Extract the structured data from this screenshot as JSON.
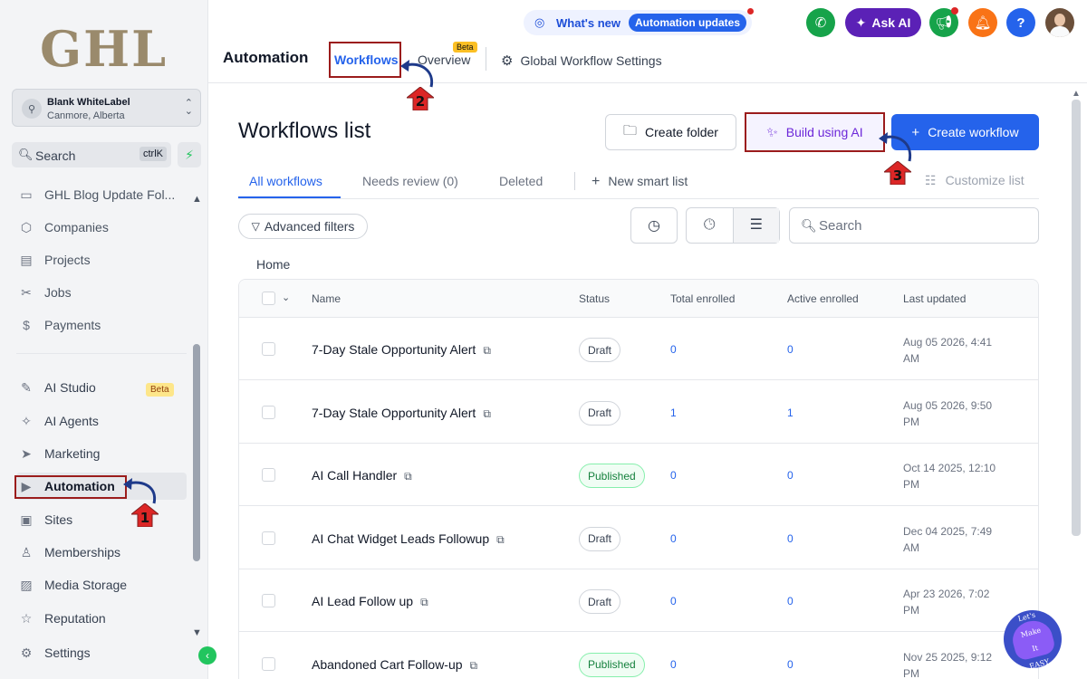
{
  "sidebar": {
    "logo": "GHL",
    "account": {
      "name": "Blank WhiteLabel",
      "location": "Canmore, Alberta"
    },
    "search": {
      "label": "Search",
      "shortcut": "ctrlK"
    },
    "items": [
      {
        "label": "GHL Blog Update Fol...",
        "icon": "blog-icon"
      },
      {
        "label": "Companies",
        "icon": "companies-icon"
      },
      {
        "label": "Projects",
        "icon": "projects-icon"
      },
      {
        "label": "Jobs",
        "icon": "jobs-icon"
      },
      {
        "label": "Payments",
        "icon": "payments-icon"
      },
      {
        "label": "AI Studio",
        "icon": "ai-studio-icon",
        "badge": "Beta"
      },
      {
        "label": "AI Agents",
        "icon": "ai-agents-icon"
      },
      {
        "label": "Marketing",
        "icon": "marketing-icon"
      },
      {
        "label": "Automation",
        "icon": "automation-icon"
      },
      {
        "label": "Sites",
        "icon": "sites-icon"
      },
      {
        "label": "Memberships",
        "icon": "memberships-icon"
      },
      {
        "label": "Media Storage",
        "icon": "media-storage-icon"
      },
      {
        "label": "Reputation",
        "icon": "reputation-icon"
      },
      {
        "label": "Settings",
        "icon": "settings-icon"
      }
    ]
  },
  "header": {
    "whats_new": "What's new",
    "automation_updates": "Automation updates",
    "ask_ai": "Ask AI",
    "app_title": "Automation",
    "tabs": [
      {
        "label": "Workflows"
      },
      {
        "label": "Overview",
        "badge": "Beta"
      },
      {
        "label": "Global Workflow Settings"
      }
    ]
  },
  "main": {
    "title": "Workflows list",
    "buttons": {
      "create_folder": "Create folder",
      "build_ai": "Build using AI",
      "create_workflow": "Create workflow"
    },
    "tabs": [
      {
        "label": "All workflows"
      },
      {
        "label": "Needs review (0)"
      },
      {
        "label": "Deleted"
      }
    ],
    "new_smart_list": "New smart list",
    "customize_list": "Customize list",
    "advanced_filters": "Advanced filters",
    "search_placeholder": "Search",
    "breadcrumb": "Home"
  },
  "table": {
    "columns": [
      "Name",
      "Status",
      "Total enrolled",
      "Active enrolled",
      "Last updated"
    ],
    "rows": [
      {
        "name": "7-Day Stale Opportunity Alert",
        "status": "Draft",
        "total": "0",
        "active": "0",
        "updated_1": "Aug 05 2026, 4:41",
        "updated_2": "AM"
      },
      {
        "name": "7-Day Stale Opportunity Alert",
        "status": "Draft",
        "total": "1",
        "active": "1",
        "updated_1": "Aug 05 2026, 9:50",
        "updated_2": "PM"
      },
      {
        "name": "AI Call Handler",
        "status": "Published",
        "total": "0",
        "active": "0",
        "updated_1": "Oct 14 2025, 12:10",
        "updated_2": "PM"
      },
      {
        "name": "AI Chat Widget Leads Followup",
        "status": "Draft",
        "total": "0",
        "active": "0",
        "updated_1": "Dec 04 2025, 7:49",
        "updated_2": "AM"
      },
      {
        "name": "AI Lead Follow up",
        "status": "Draft",
        "total": "0",
        "active": "0",
        "updated_1": "Apr 23 2026, 7:02",
        "updated_2": "PM"
      },
      {
        "name": "Abandoned Cart Follow-up",
        "status": "Published",
        "total": "0",
        "active": "0",
        "updated_1": "Nov 25 2025, 9:12",
        "updated_2": "PM"
      }
    ]
  },
  "annotations": {
    "step1": "1",
    "step2": "2",
    "step3": "3"
  },
  "watermark": {
    "line1": "Let's Make",
    "line2": "It",
    "line3": "EASY"
  },
  "colors": {
    "primary": "#2563eb",
    "annotation": "#9b1c1c",
    "ai_purple": "#5b21b6",
    "published": "#15803d"
  }
}
